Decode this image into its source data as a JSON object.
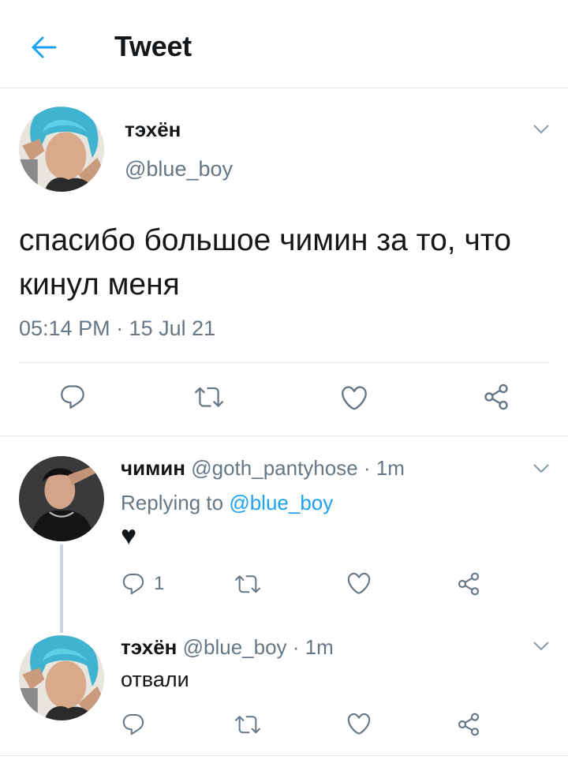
{
  "header": {
    "title": "Tweet"
  },
  "main_tweet": {
    "name": "тэхён",
    "handle": "@blue_boy",
    "text": "спасибо большое чимин за то, что кинул меня",
    "time": "05:14 PM · 15 Jul 21"
  },
  "replies": [
    {
      "name": "чимин",
      "meta": "@goth_pantyhose · 1m",
      "replying_label": "Replying to",
      "replying_to": "@blue_boy",
      "text": "♥",
      "reply_count": "1"
    },
    {
      "name": "тэхён",
      "meta": "@blue_boy · 1m",
      "text": "отвали"
    }
  ],
  "colors": {
    "accent": "#1da1f2",
    "secondary_text": "#657786",
    "icon_gray": "#657786",
    "divider": "#e1e8ed"
  },
  "icons": [
    "back-arrow-icon",
    "chevron-down-icon",
    "reply-icon",
    "retweet-icon",
    "like-icon",
    "share-icon"
  ]
}
